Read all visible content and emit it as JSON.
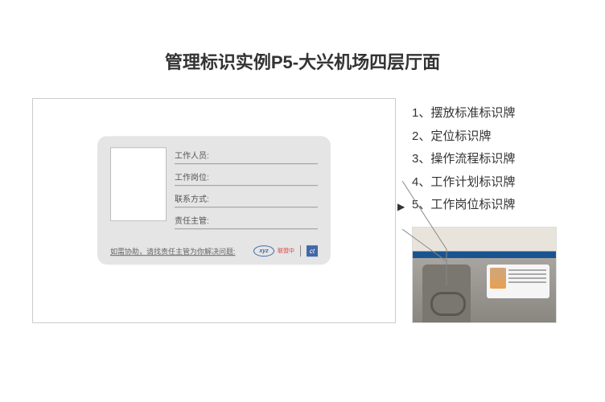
{
  "title": "管理标识实例P5-大兴机场四层厅面",
  "card": {
    "fields": [
      "工作人员:",
      "工作岗位:",
      "联系方式:",
      "责任主管:"
    ],
    "footer": "如需协助，请找责任主管为你解决问题:",
    "logo1": "xyz",
    "logo1_tag": "联盟中",
    "logo2": "ct"
  },
  "list": [
    "1、摆放标准标识牌",
    "2、定位标识牌",
    "3、操作流程标识牌",
    "4、工作计划标识牌",
    "5、工作岗位标识牌"
  ]
}
